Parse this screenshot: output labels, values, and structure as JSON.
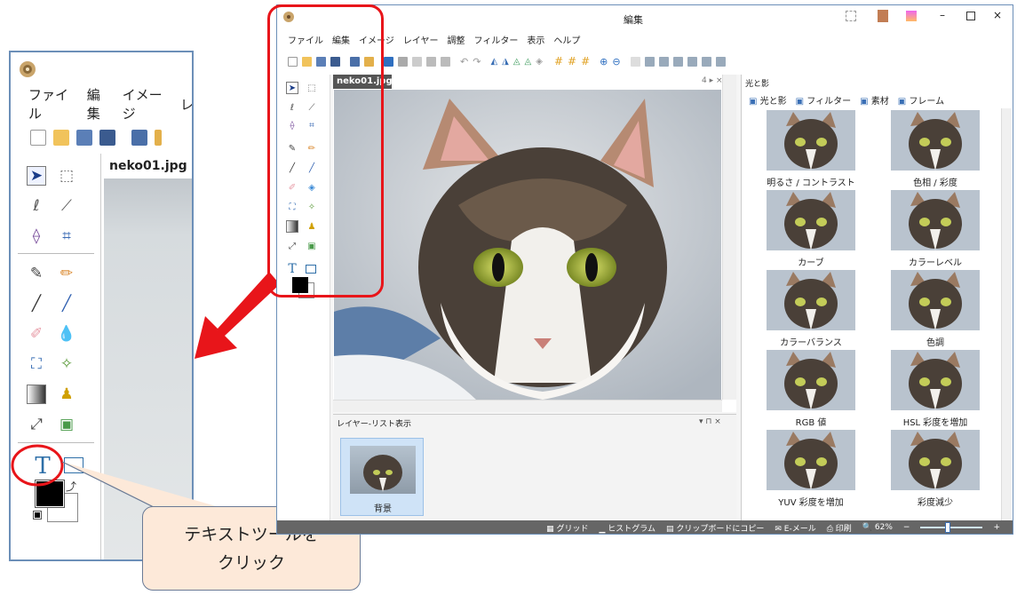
{
  "zoom_panel": {
    "menu": [
      "ファイル",
      "編集",
      "イメージ",
      "レ"
    ],
    "doc_tab": "neko01.jpg"
  },
  "callout": {
    "line1": "テキストツールを",
    "line2": "クリック"
  },
  "window": {
    "title": "編集",
    "menu": [
      "ファイル",
      "編集",
      "イメージ",
      "レイヤー",
      "調整",
      "フィルター",
      "表示",
      "ヘルプ"
    ],
    "doc_tab": "neko01.jpg",
    "canvas_panel_controls": "4 ▸ ×",
    "layer_panel": {
      "title": "レイヤー-リスト表示",
      "controls": "▾ ⊓ ×",
      "layer_name": "背景"
    },
    "right_panel": {
      "title": "光と影",
      "tabs": [
        "光と影",
        "フィルター",
        "素材",
        "フレーム"
      ],
      "items": [
        "明るさ / コントラスト",
        "色相 / 彩度",
        "カーブ",
        "カラーレベル",
        "カラーバランス",
        "色調",
        "RGB 値",
        "HSL 彩度を増加",
        "YUV 彩度を増加",
        "彩度減少"
      ]
    },
    "status_bar": {
      "grid": "グリッド",
      "histogram": "ヒストグラム",
      "clipboard": "クリップボードにコピー",
      "email": "E-メール",
      "print": "印刷",
      "zoom": "62%",
      "zoom_minus": "−",
      "zoom_plus": "+"
    }
  },
  "colors": {
    "highlight_red": "#e8151a",
    "accent_blue": "#3a6fb5",
    "callout_fill": "#fde9d9"
  }
}
